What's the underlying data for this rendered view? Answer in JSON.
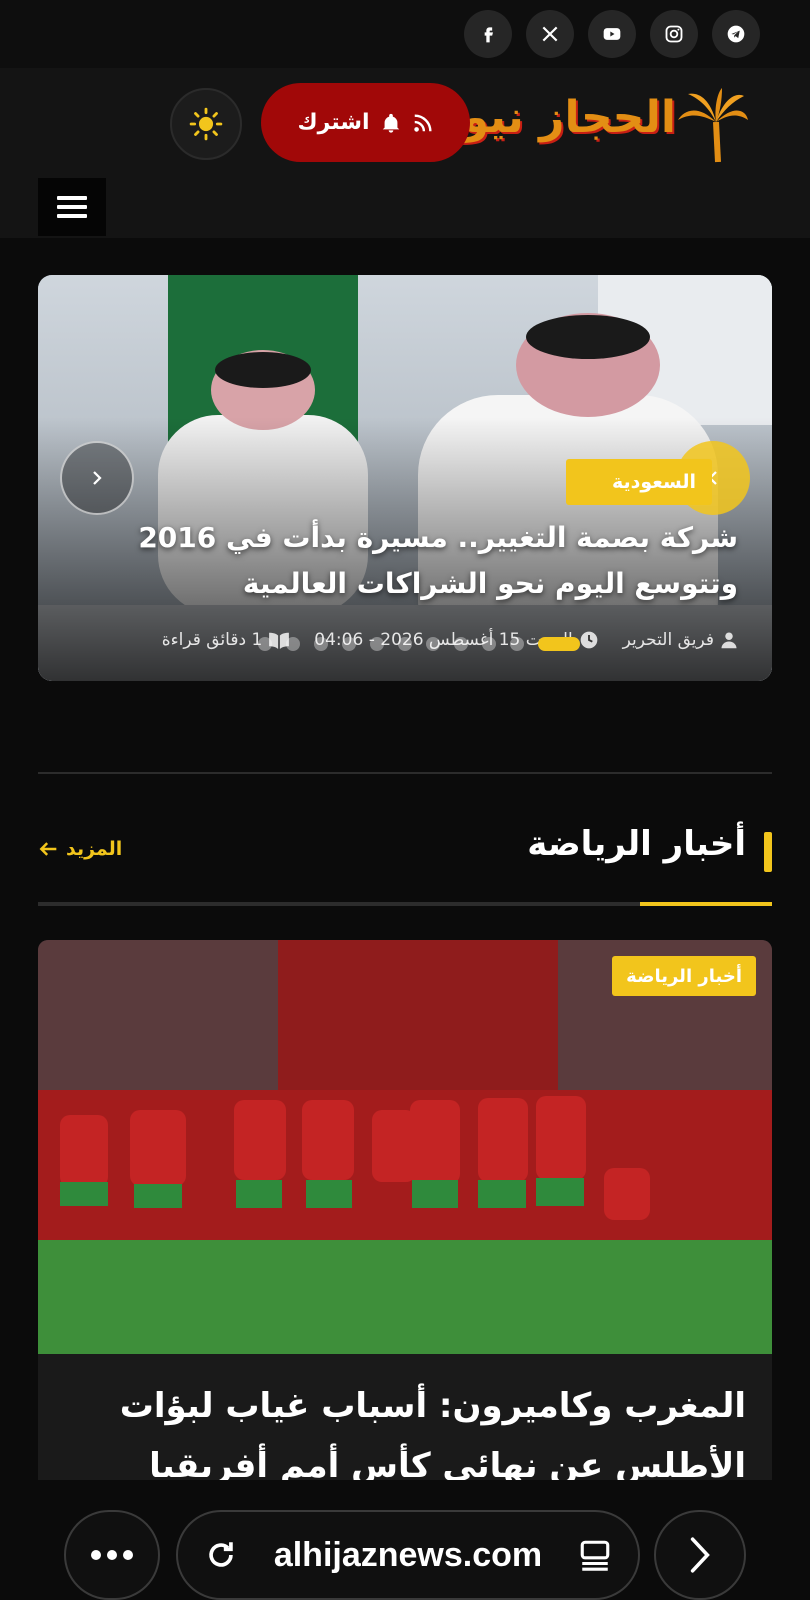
{
  "social": {
    "icons": [
      "facebook-icon",
      "x-twitter-icon",
      "youtube-icon",
      "instagram-icon",
      "telegram-icon"
    ]
  },
  "header": {
    "logo_text": "الحجاز نيوز",
    "subscribe_label": "اشترك",
    "colors": {
      "subscribe_bg": "#a10808",
      "accent": "#f2c51c",
      "logo_orange": "#e38e14",
      "logo_red": "#c81f14"
    }
  },
  "slider": {
    "category": "السعودية",
    "title": "شركة بصمة التغيير.. مسيرة بدأت في 2016 وتتوسع اليوم نحو الشراكات العالمية",
    "author": "فريق التحرير",
    "date": "السبت 15 أغسطس 2026 - 04:06",
    "read_time": "1 دقائق قراءة",
    "dots_count": 11,
    "active_dot": 0
  },
  "section": {
    "title": "أخبار الرياضة",
    "more_label": "المزيد"
  },
  "card": {
    "category": "أخبار الرياضة",
    "title": "المغرب وكاميرون: أسباب غياب لبؤات الأطلس عن نهائي كأس أمم أفريقيا"
  },
  "browser": {
    "url": "alhijaznews.com"
  }
}
